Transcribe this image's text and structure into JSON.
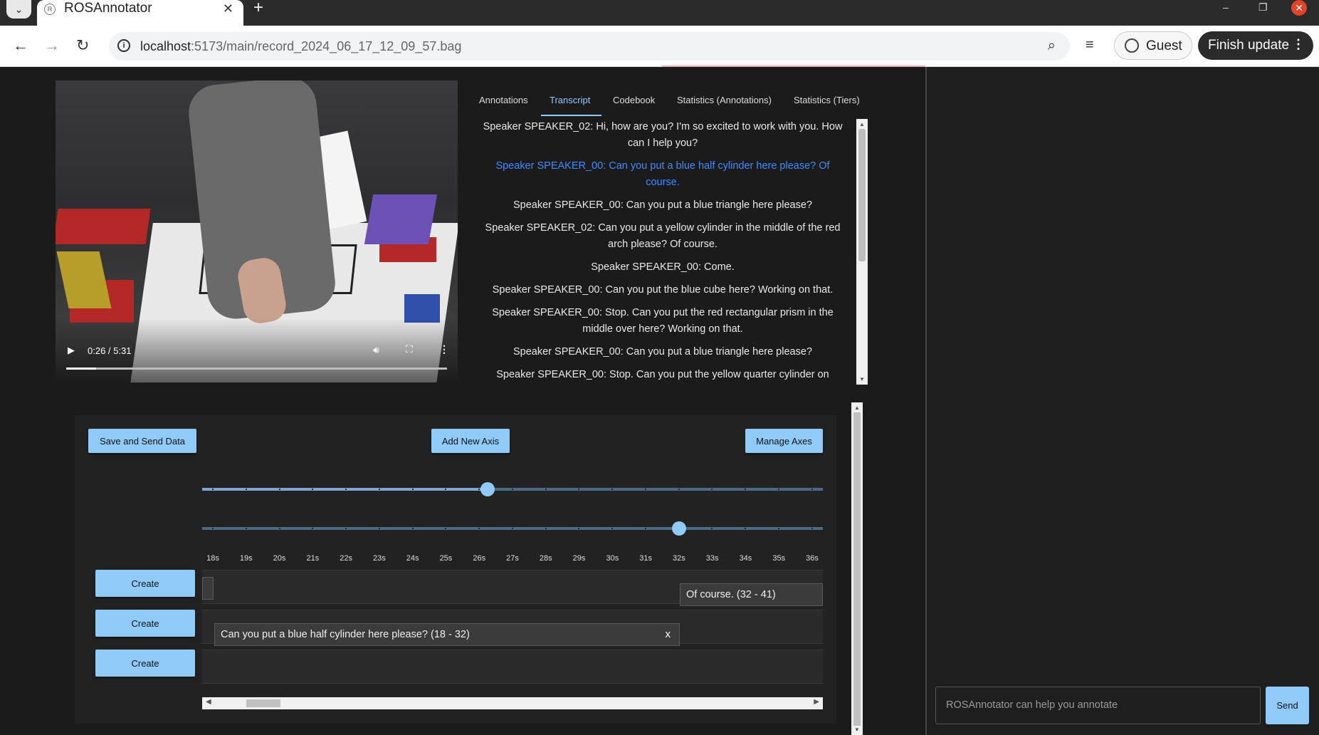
{
  "browser": {
    "tab_title": "ROSAnnotator",
    "url_host": "localhost",
    "url_path": ":5173/main/record_2024_06_17_12_09_57.bag",
    "guest_label": "Guest",
    "finish_label": "Finish update"
  },
  "video": {
    "time": "0:26 / 5:31",
    "progress": 0.079
  },
  "tabs": [
    "Annotations",
    "Transcript",
    "Codebook",
    "Statistics (Annotations)",
    "Statistics (Tiers)"
  ],
  "active_tab": "Transcript",
  "transcript": [
    "Speaker SPEAKER_02: Hi, how are you? I'm so excited to work with you. How can I help you?",
    "Speaker SPEAKER_00: Can you put a blue half cylinder here please? Of course.",
    "Speaker SPEAKER_00: Can you put a blue triangle here please?",
    "Speaker SPEAKER_02: Can you put a yellow cylinder in the middle of the red arch please? Of course.",
    "Speaker SPEAKER_00: Come.",
    "Speaker SPEAKER_00: Can you put the blue cube here? Working on that.",
    "Speaker SPEAKER_00: Stop. Can you put the red rectangular prism in the middle over here? Working on that.",
    "Speaker SPEAKER_00: Can you put a blue triangle here please?",
    "Speaker SPEAKER_00: Stop. Can you put the yellow quarter cylinder on"
  ],
  "toolbar": {
    "save_label": "Save and Send Data",
    "add_axis_label": "Add New Axis",
    "manage_axes_label": "Manage Axes"
  },
  "timeline": {
    "time_labels": [
      "18s",
      "19s",
      "20s",
      "21s",
      "22s",
      "23s",
      "24s",
      "25s",
      "26s",
      "27s",
      "28s",
      "29s",
      "30s",
      "31s",
      "32s",
      "33s",
      "34s",
      "35s",
      "36s"
    ],
    "slider1_value": "26s",
    "slider2_value": "32s",
    "create_label": "Create",
    "segment_row1": "Of course. (32 - 41)",
    "segment_row2": "Can you put a blue half cylinder here please? (18 - 32)",
    "segment_close": "x"
  },
  "chat": {
    "placeholder": "ROSAnnotator can help you annotate",
    "send_label": "Send"
  }
}
